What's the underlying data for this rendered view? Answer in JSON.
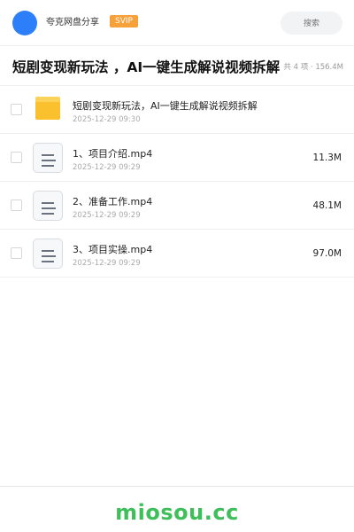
{
  "header": {
    "username": "夸克网盘分享",
    "badge": "SVIP",
    "search_placeholder": "搜索",
    "colors": {
      "avatar": "#2d7ff9",
      "badge": "#f7a13a"
    }
  },
  "share": {
    "title": "短剧变现新玩法 ，AI一键生成解说视频拆解",
    "summary": "共 4 项 · 156.4M"
  },
  "items": [
    {
      "type": "folder",
      "icon": "folder-icon",
      "name": "短剧变现新玩法，AI一键生成解说视频拆解",
      "date": "2025-12-29 09:30",
      "size": ""
    },
    {
      "type": "file",
      "icon": "video-file-icon",
      "name": "1、项目介绍.mp4",
      "date": "2025-12-29 09:29",
      "size": "11.3M"
    },
    {
      "type": "file",
      "icon": "video-file-icon",
      "name": "2、准备工作.mp4",
      "date": "2025-12-29 09:29",
      "size": "48.1M"
    },
    {
      "type": "file",
      "icon": "video-file-icon",
      "name": "3、项目实操.mp4",
      "date": "2025-12-29 09:29",
      "size": "97.0M"
    }
  ],
  "footer": {
    "brand": "miosou.cc",
    "brand_color": "#3fbf5a"
  }
}
